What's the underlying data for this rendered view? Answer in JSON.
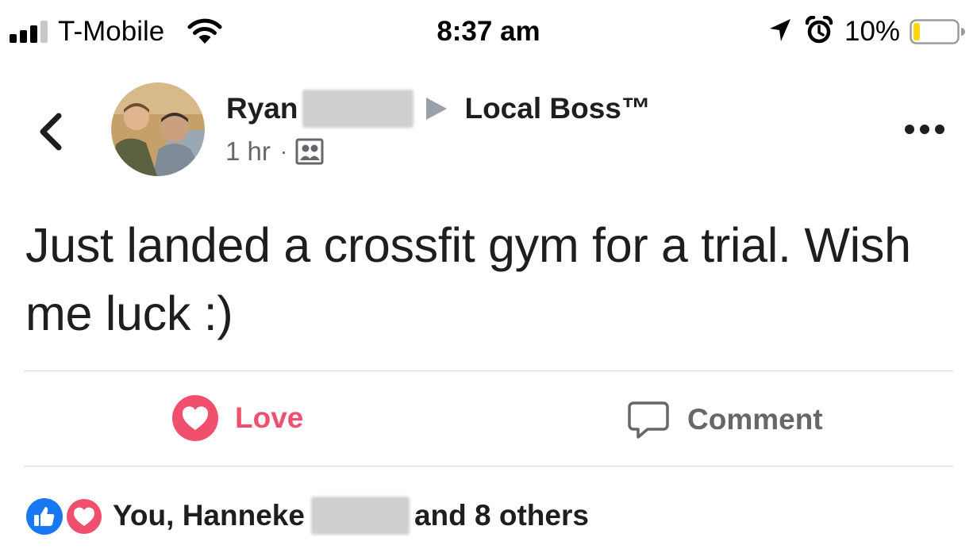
{
  "status_bar": {
    "carrier": "T-Mobile",
    "time": "8:37 am",
    "battery_percent": "10%",
    "signal_icon": "signal-bars-icon",
    "wifi_icon": "wifi-icon",
    "location_icon": "location-arrow-icon",
    "alarm_icon": "alarm-clock-icon",
    "battery_icon": "battery-low-icon",
    "battery_level": 0.1,
    "battery_color": "#ffd60a"
  },
  "post": {
    "author_first_name": "Ryan",
    "group_name": "Local Boss™",
    "timestamp": "1 hr",
    "separator": "·",
    "audience_icon": "group-members-icon",
    "text": "Just landed a crossfit gym for a trial. Wish me luck :)"
  },
  "actions": {
    "love_label": "Love",
    "comment_label": "Comment",
    "love_color": "#f0506e",
    "comment_color": "#65676b"
  },
  "reactions": {
    "names_prefix": "You, Hanneke",
    "names_suffix": "and 8 others",
    "like_color": "#1877f2",
    "love_color": "#f0506e"
  }
}
